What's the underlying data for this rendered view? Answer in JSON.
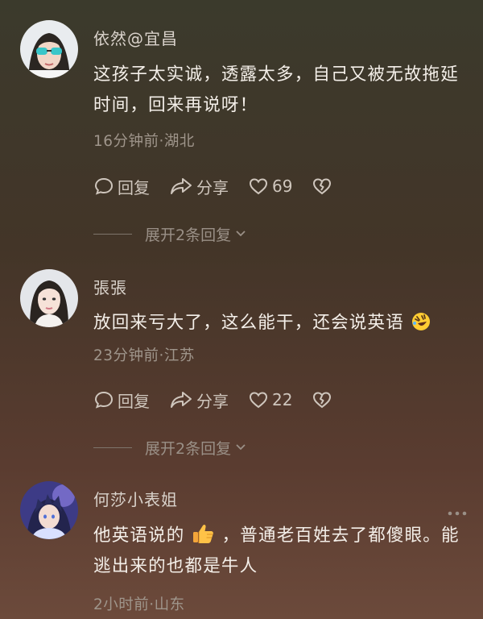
{
  "comments": [
    {
      "username": "依然@宜昌",
      "content": "这孩子太实诚，透露太多，自己又被无故拖延时间，回来再说呀！",
      "meta": "16分钟前·湖北",
      "reply_label": "回复",
      "share_label": "分享",
      "likes": "69",
      "expand_label": "展开2条回复"
    },
    {
      "username": "張張",
      "content": "放回来亏大了，这么能干，还会说英语",
      "meta": "23分钟前·江苏",
      "reply_label": "回复",
      "share_label": "分享",
      "likes": "22",
      "expand_label": "展开2条回复"
    },
    {
      "username": "何莎小表姐",
      "content_part1": "他英语说的",
      "content_part2": "，普通老百姓去了都傻眼。能逃出来的也都是牛人",
      "meta": "2小时前·山东"
    }
  ],
  "icons": {
    "reply": "comment-bubble-icon",
    "share": "share-arrow-icon",
    "like": "heart-outline-icon",
    "dislike": "broken-heart-icon",
    "expand": "chevron-down-icon",
    "more": "more-dots-icon",
    "emoji_laugh": "rolling-laughing-emoji",
    "emoji_thumb": "thumbs-up-emoji"
  }
}
